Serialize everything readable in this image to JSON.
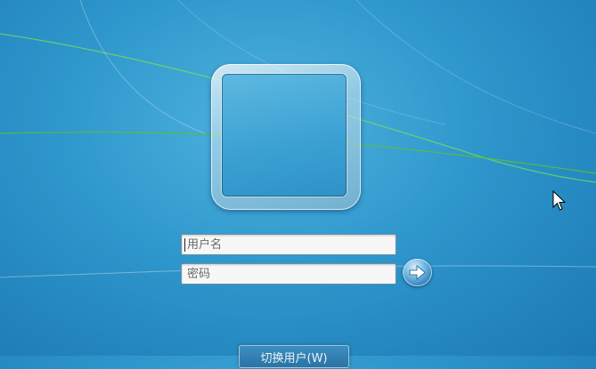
{
  "login": {
    "username_placeholder": "用户名",
    "password_placeholder": "密码",
    "submit_icon": "arrow-right-icon",
    "switch_user_label": "切换用户(W)"
  },
  "colors": {
    "background": "#2e97cc",
    "field_bg": "#f7f7f8",
    "button_blue": "#2f7fbf"
  }
}
